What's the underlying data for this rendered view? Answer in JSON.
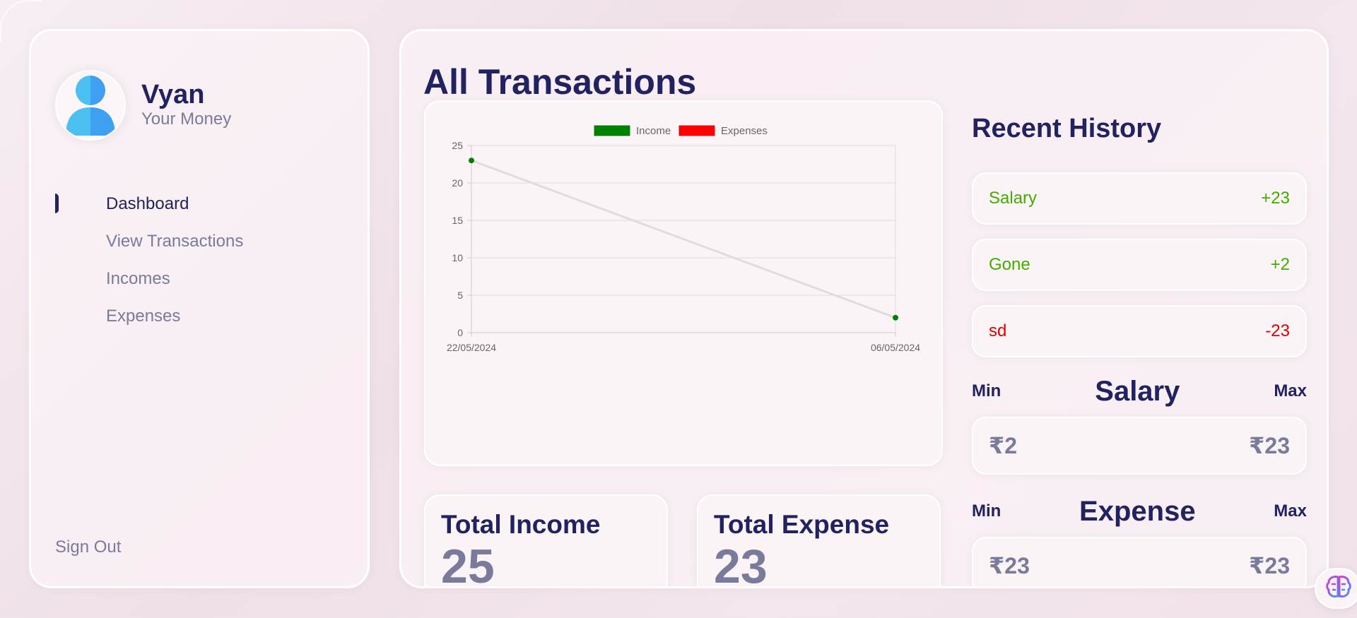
{
  "profile": {
    "name": "Vyan",
    "subtitle": "Your Money"
  },
  "menu": [
    {
      "label": "Dashboard",
      "active": true
    },
    {
      "label": "View Transactions",
      "active": false
    },
    {
      "label": "Incomes",
      "active": false
    },
    {
      "label": "Expenses",
      "active": false
    }
  ],
  "signout_label": "Sign Out",
  "page_title": "All Transactions",
  "chart_data": {
    "type": "line",
    "categories": [
      "22/05/2024",
      "06/05/2024"
    ],
    "series": [
      {
        "name": "Income",
        "values": [
          23,
          2
        ],
        "color": "#008000"
      },
      {
        "name": "Expenses",
        "values": [],
        "color": "#ff0000"
      }
    ],
    "yticks": [
      0,
      5,
      10,
      15,
      20,
      25
    ],
    "ylim": [
      0,
      25
    ],
    "grid": true,
    "legend": "top-center",
    "xlabel": "",
    "ylabel": ""
  },
  "stats": {
    "total_income_label": "Total Income",
    "total_income_value": "25",
    "total_expense_label": "Total Expense",
    "total_expense_value": "23"
  },
  "history": {
    "title": "Recent History",
    "items": [
      {
        "label": "Salary",
        "amount": "+23",
        "type": "income"
      },
      {
        "label": "Gone",
        "amount": "+2",
        "type": "income"
      },
      {
        "label": "sd",
        "amount": "-23",
        "type": "expense"
      }
    ]
  },
  "salary_range": {
    "min_label": "Min",
    "title": "Salary",
    "max_label": "Max",
    "min_value": "₹2",
    "max_value": "₹23"
  },
  "expense_range": {
    "min_label": "Min",
    "title": "Expense",
    "max_label": "Max",
    "min_value": "₹23",
    "max_value": "₹23"
  },
  "colors": {
    "primary": "#222260",
    "muted": "#7a7a9a",
    "income": "#42ad00",
    "expense": "#e00000"
  },
  "icons": {
    "avatar": "user-avatar-icon",
    "assistant": "brain-icon"
  }
}
